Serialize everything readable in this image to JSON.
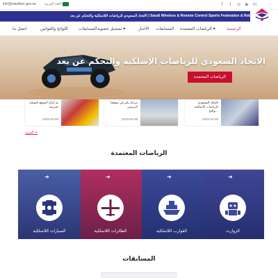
{
  "topbar": {
    "email": "info@saudisrc.gov.sa",
    "language": "اللغة العربية",
    "social_icons": [
      "f",
      "t",
      "◎",
      "▶",
      "in"
    ]
  },
  "header_strip": {
    "text": "الاتحاد السعودي للرياضات اللاسلكية والتحكم عن بعد | Saudi Wireless & Remote Control Sports Federation & Robot"
  },
  "nav": {
    "items": [
      {
        "label": "الرئيسية",
        "active": true
      },
      {
        "label": "الرياضات المعتمدة ▾",
        "active": false
      },
      {
        "label": "المسابقات",
        "active": false
      },
      {
        "label": "الأخبار",
        "active": false
      },
      {
        "label": "تسجيل عضوية ▾",
        "active": false
      },
      {
        "label": "المسابقات",
        "active": false
      },
      {
        "label": "اللوائح والقوانين",
        "active": false
      },
      {
        "label": "اتصل بنا",
        "active": false
      }
    ]
  },
  "hero": {
    "title": "الاتحاد السعودي للرياضات الإسلكية والتحكم عن بعد",
    "button_label": "الرياضات المعتمدة"
  },
  "news": {
    "cards": [
      {
        "title": "الإتحاد السعودي للرياضات الاسلكية والتح...",
        "date": "2020-03-09"
      },
      {
        "title": "مرحبا بكم في موقعنا الرسمي",
        "date": "2020-03-09"
      },
      {
        "title": "تم انتاج الموقع كنسخة تجريبية",
        "date": "2020-03-09"
      }
    ],
    "more_link": "المزيد +"
  },
  "sports": {
    "section_title": "الرياضات المعتمدة",
    "items": [
      {
        "label": "الزوارت",
        "color": "#3f4796",
        "icon": "robot-icon"
      },
      {
        "label": "القوارب اللاسلكية",
        "color": "#3c4a9a",
        "icon": "ship-icon"
      },
      {
        "label": "الطائرات اللاسلكية",
        "color": "#b02e5e",
        "icon": "airplane-icon"
      },
      {
        "label": "السيارات اللاسلكية",
        "color": "#4a5fa5",
        "icon": "car-icon"
      }
    ]
  },
  "competitions": {
    "section_title": "المسابقات"
  },
  "colors": {
    "brand_blue": "#2e3192",
    "accent_red": "#c8102e",
    "accent_pink": "#d81e5b"
  }
}
